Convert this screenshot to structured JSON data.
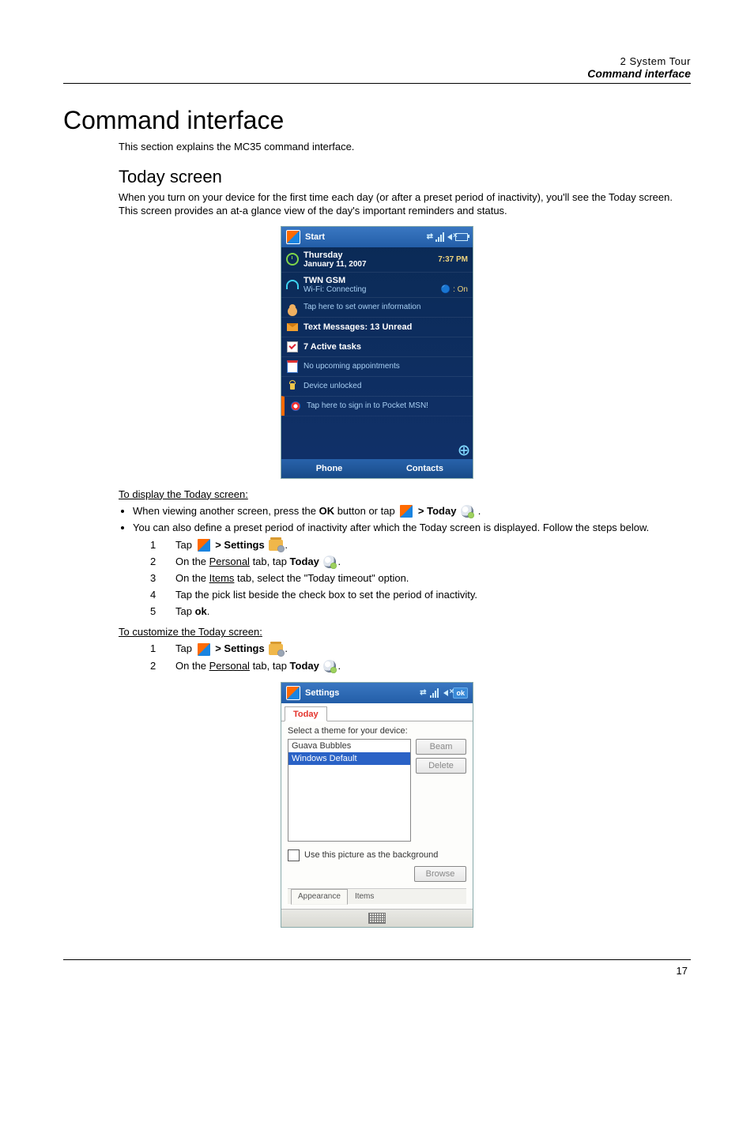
{
  "header": {
    "line1": "2 System Tour",
    "line2": "Command interface"
  },
  "section_title": "Command interface",
  "intro_text": "This section explains the MC35 command interface.",
  "subsection_title": "Today screen",
  "subsection_text": "When you turn on your device for the first time each day (or after a preset period of inactivity), you'll see the Today screen. This screen provides an at-a glance view of the day's important reminders and status.",
  "today_screen": {
    "title": "Start",
    "date_line1": "Thursday",
    "date_line2": "January 11, 2007",
    "time": "7:37 PM",
    "conn_line1": "TWN GSM",
    "conn_line2": "Wi-Fi: Connecting",
    "bt_status": "🔵 : On",
    "owner": "Tap here to set owner information",
    "messages": "Text Messages: 13 Unread",
    "tasks": "7 Active tasks",
    "appts": "No upcoming appointments",
    "lock": "Device unlocked",
    "msn": "Tap here to sign in to Pocket MSN!",
    "soft_left": "Phone",
    "soft_right": "Contacts"
  },
  "to_display_title": "To display the Today screen:",
  "bullet1_pre": "When viewing another screen, press the ",
  "bullet1_ok": "OK",
  "bullet1_mid": " button or tap ",
  "bullet1_arrow": " > ",
  "bullet1_today": "Today",
  "bullet1_end": " .",
  "bullet2": "You can also define a preset period of inactivity after which the Today screen is displayed. Follow the steps below.",
  "steps1": {
    "s1_pre": "Tap ",
    "s1_arrow": " > ",
    "s1_settings": "Settings ",
    "s2_pre": "On the ",
    "s2_u": "Personal",
    "s2_mid": " tab, tap ",
    "s2_today": "Today ",
    "s2_end": ".",
    "s3_pre": "On the ",
    "s3_u": "Items",
    "s3_end": " tab, select the \"Today timeout\" option.",
    "s4": "Tap the pick list beside the check box to set the period of inactivity.",
    "s5_pre": "Tap ",
    "s5_ok": "ok",
    "s5_end": "."
  },
  "to_customize_title": "To customize the Today screen:",
  "steps2": {
    "s1_pre": "Tap ",
    "s1_arrow": " > ",
    "s1_settings": "Settings ",
    "s2_pre": "On the ",
    "s2_u": "Personal",
    "s2_mid": " tab, tap ",
    "s2_today": "Today ",
    "s2_end": "."
  },
  "settings_screen": {
    "title": "Settings",
    "ok": "ok",
    "top_tab": "Today",
    "label": "Select a theme for your device:",
    "item1": "Guava Bubbles",
    "item2": "Windows Default",
    "btn_beam": "Beam",
    "btn_delete": "Delete",
    "checkbox_label": "Use this picture as the background",
    "btn_browse": "Browse",
    "bottom_tab1": "Appearance",
    "bottom_tab2": "Items"
  },
  "page_number": "17"
}
